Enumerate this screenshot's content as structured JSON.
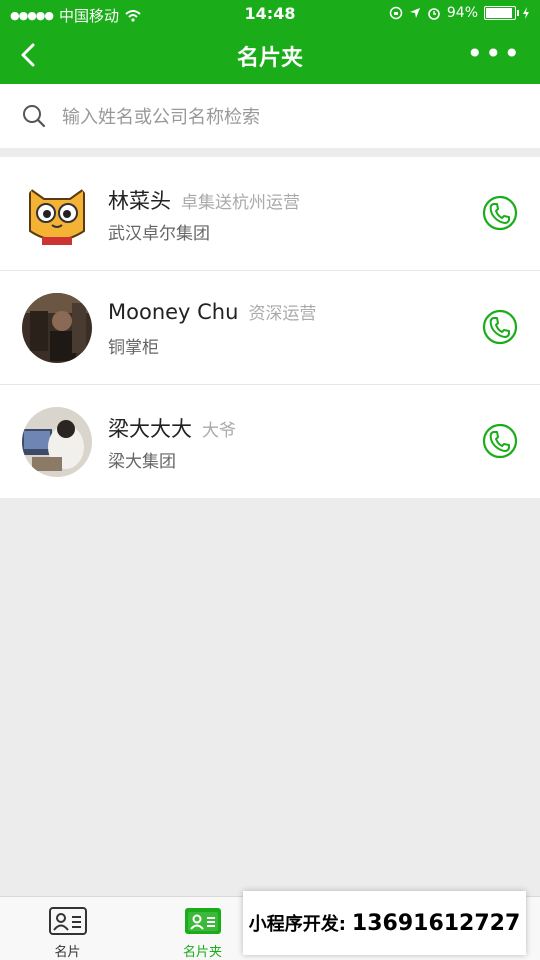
{
  "status": {
    "carrier": "中国移动",
    "time": "14:48",
    "battery": "94%"
  },
  "nav": {
    "title": "名片夹"
  },
  "search": {
    "placeholder": "输入姓名或公司名称检索"
  },
  "contacts": [
    {
      "name": "林菜头",
      "title": "卓集送杭州运营",
      "company": "武汉卓尔集团"
    },
    {
      "name": "Mooney Chu",
      "title": "资深运营",
      "company": "铜掌柜"
    },
    {
      "name": "梁大大大",
      "title": "大爷",
      "company": "梁大集团"
    }
  ],
  "tabs": [
    {
      "label": "名片"
    },
    {
      "label": "名片夹"
    },
    {
      "label": ""
    },
    {
      "label": ""
    }
  ],
  "promo": {
    "label": "小程序开发:",
    "phone": "13691612727"
  },
  "colors": {
    "accent": "#1aad19"
  }
}
